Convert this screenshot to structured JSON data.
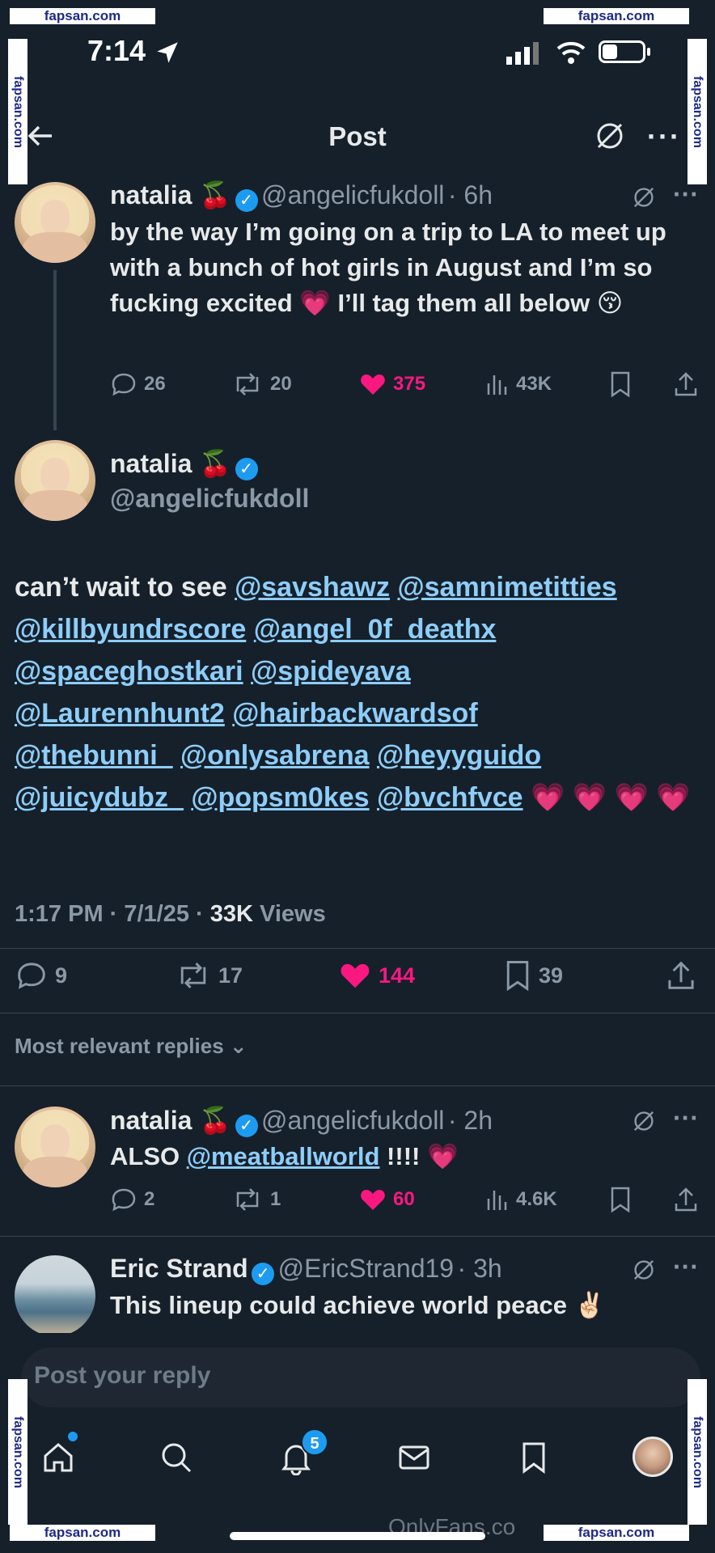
{
  "watermark": {
    "text": "fapsan.com"
  },
  "status_bar": {
    "time": "7:14"
  },
  "header": {
    "title": "Post"
  },
  "thread": [
    {
      "display_name": "natalia 🍒",
      "handle": "@angelicfukdoll",
      "time": "· 6h",
      "text": "by the way I’m going on a trip to LA to meet up with a bunch of hot girls in August and I’m so fucking excited 💗 I’ll tag them all below 😚",
      "replies": "26",
      "reposts": "20",
      "likes": "375",
      "views": "43K"
    }
  ],
  "main_post": {
    "display_name": "natalia 🍒",
    "handle": "@angelicfukdoll",
    "intro": "can’t wait to see",
    "mentions": [
      "@savshawz",
      "@samnimetitties",
      "@killbyundrscore",
      "@angel_0f_deathx",
      "@spaceghostkari",
      "@spideyava",
      "@Laurennhunt2",
      "@hairbackwardsof",
      "@thebunni_",
      "@onlysabrena",
      "@heyyguido",
      "@juicydubz_",
      "@popsm0kes",
      "@bvchfvce"
    ],
    "hearts": "💗 💗 💗 💗",
    "timestamp": "1:17 PM · 7/1/25 · ",
    "views_count": "33K",
    "views_label": "Views",
    "replies": "9",
    "reposts": "17",
    "likes": "144",
    "bookmarks": "39"
  },
  "sort_label": "Most relevant replies",
  "replies": [
    {
      "display_name": "natalia 🍒",
      "handle": "@angelicfukdoll",
      "time": "· 2h",
      "text_prefix": "ALSO",
      "mention": "@meatballworld",
      "text_suffix": "!!!! 💗",
      "replies": "2",
      "reposts": "1",
      "likes": "60",
      "views": "4.6K"
    },
    {
      "display_name": "Eric Strand",
      "handle": "@EricStrand19",
      "time": "· 3h",
      "text": "This lineup could achieve world peace ✌🏻"
    }
  ],
  "compose": {
    "placeholder": "Post your reply"
  },
  "nav": {
    "notifications_count": "5"
  },
  "footer_watermark": "OnlyFans.co"
}
